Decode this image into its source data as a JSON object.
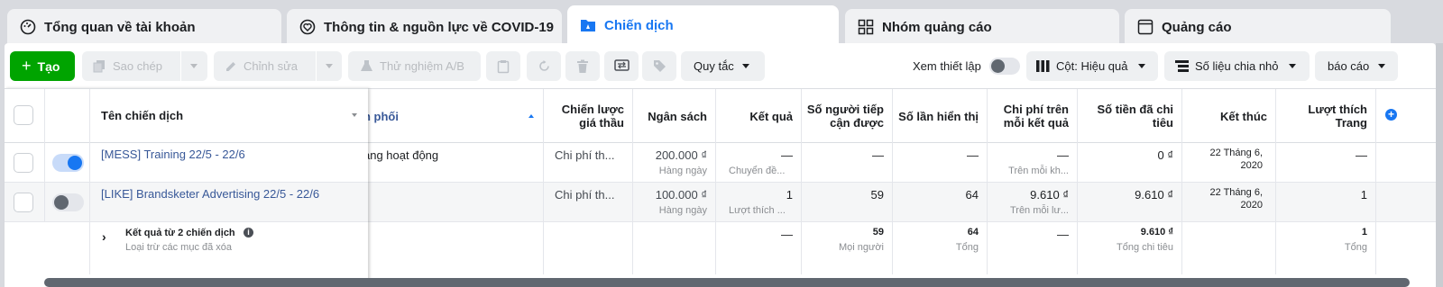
{
  "tabs": [
    {
      "label": "Tổng quan về tài khoản",
      "icon": "dashboard-icon"
    },
    {
      "label": "Thông tin & nguồn lực về COVID-19",
      "icon": "heart-icon"
    },
    {
      "label": "Chiến dịch",
      "icon": "folder-icon",
      "active": true
    },
    {
      "label": "Nhóm quảng cáo",
      "icon": "grid-icon"
    },
    {
      "label": "Quảng cáo",
      "icon": "window-icon"
    }
  ],
  "toolbar": {
    "create": "Tạo",
    "copy": "Sao chép",
    "edit": "Chỉnh sửa",
    "ab_test": "Thử nghiệm A/B",
    "rules": "Quy tắc",
    "view_setup": "Xem thiết lập",
    "columns": "Cột: Hiệu quả",
    "breakdown": "Số liệu chia nhỏ",
    "reports": "báo cáo"
  },
  "columns": {
    "name": "Tên chiến dịch",
    "delivery": "n phối",
    "bid_strategy": "Chiến lược giá thầu",
    "budget": "Ngân sách",
    "results": "Kết quả",
    "reach": "Số người tiếp cận được",
    "impressions": "Số lần hiển thị",
    "cost_per_result": "Chi phí trên mỗi kết quả",
    "amount_spent": "Số tiền đã chi tiêu",
    "ends": "Kết thúc",
    "page_likes": "Lượt thích Trang"
  },
  "rows": [
    {
      "name": "[MESS] Training 22/5 - 22/6",
      "active": true,
      "delivery": "ang hoạt động",
      "bid_strategy": "Chi phí th...",
      "budget": "200.000 ₫",
      "budget_sub": "Hàng ngày",
      "results": "—",
      "results_sub": "Chuyển đề...",
      "reach": "—",
      "impressions": "—",
      "cost_per_result": "—",
      "cost_sub": "Trên mỗi kh...",
      "amount_spent": "0 ₫",
      "ends": "22 Tháng 6, 2020",
      "page_likes": "—"
    },
    {
      "name": "[LIKE] Brandsketer Advertising 22/5 - 22/6",
      "active": false,
      "delivery": "",
      "bid_strategy": "Chi phí th...",
      "budget": "100.000 ₫",
      "budget_sub": "Hàng ngày",
      "results": "1",
      "results_sub": "Lượt thích ...",
      "reach": "59",
      "impressions": "64",
      "cost_per_result": "9.610 ₫",
      "cost_sub": "Trên mỗi lư...",
      "amount_spent": "9.610 ₫",
      "ends": "22 Tháng 6, 2020",
      "page_likes": "1"
    }
  ],
  "summary": {
    "title": "Kết quả từ 2 chiến dịch",
    "subtitle": "Loại trừ các mục đã xóa",
    "results": "—",
    "reach": "59",
    "reach_sub": "Mọi người",
    "impressions": "64",
    "impressions_sub": "Tổng",
    "cost_per_result": "—",
    "amount_spent": "9.610 ₫",
    "amount_spent_sub": "Tổng chi tiêu",
    "page_likes": "1",
    "page_likes_sub": "Tổng"
  },
  "colors": {
    "accent": "#1877f2",
    "create": "#00a400",
    "link": "#385898"
  }
}
